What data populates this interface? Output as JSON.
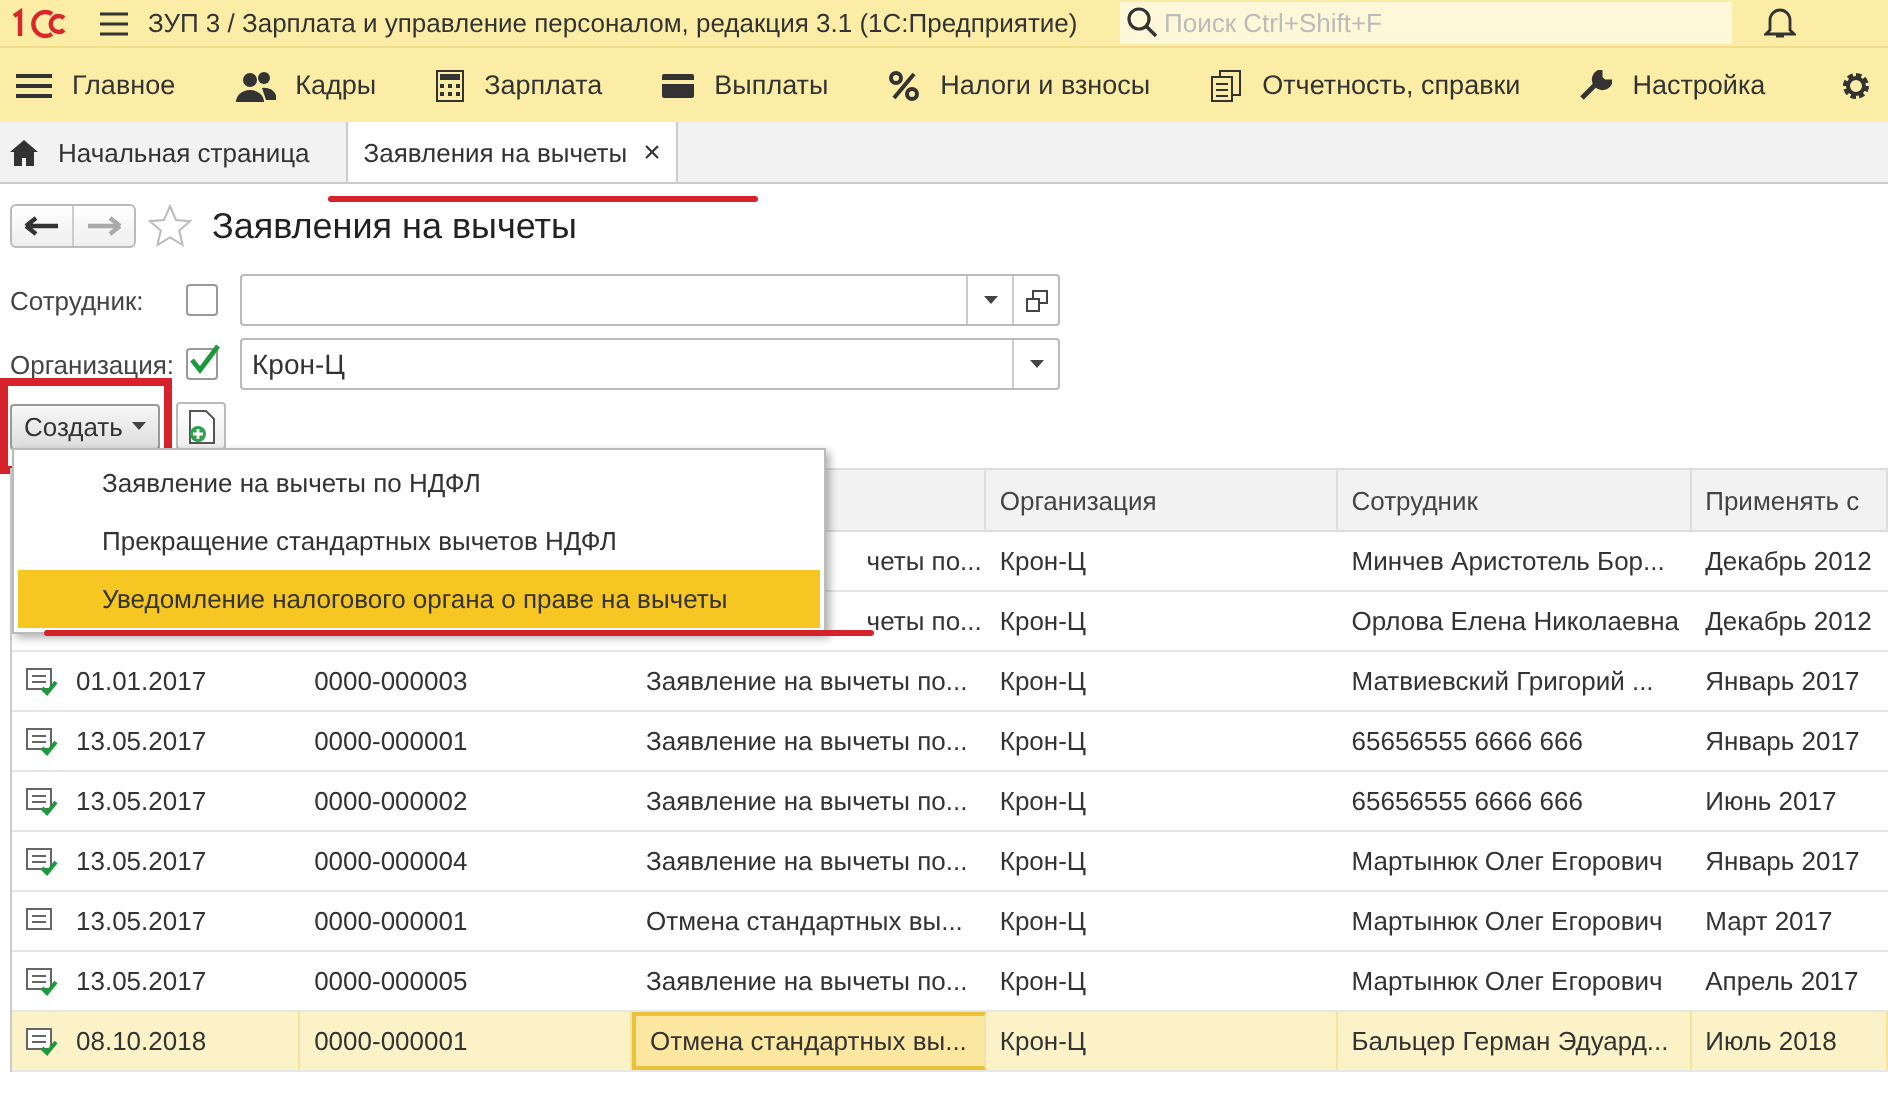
{
  "window": {
    "title": "ЗУП 3 / Зарплата и управление персоналом, редакция 3.1  (1С:Предприятие)",
    "search_placeholder": "Поиск Ctrl+Shift+F"
  },
  "sections": [
    {
      "label": "Главное"
    },
    {
      "label": "Кадры"
    },
    {
      "label": "Зарплата"
    },
    {
      "label": "Выплаты"
    },
    {
      "label": "Налоги и взносы"
    },
    {
      "label": "Отчетность, справки"
    },
    {
      "label": "Настройка"
    }
  ],
  "tabs": [
    {
      "label": "Начальная страница",
      "selected": false,
      "annotated": false
    },
    {
      "label": "Заявления на вычеты",
      "selected": true,
      "annotated": true,
      "close": "×"
    }
  ],
  "form": {
    "title": "Заявления на вычеты",
    "filters": [
      {
        "label": "Сотрудник:",
        "checked": false
      },
      {
        "label": "Организация:",
        "checked": true,
        "value": "Крон-Ц"
      }
    ],
    "create_button": {
      "label": "Создать",
      "annotated": true
    }
  },
  "menu": [
    {
      "label": "Заявление на вычеты по НДФЛ",
      "selected": false,
      "annotated": false
    },
    {
      "label": "Прекращение стандартных вычетов НДФЛ",
      "selected": false,
      "annotated": false
    },
    {
      "label": "Уведомление налогового органа о праве на вычеты",
      "selected": true,
      "annotated": true
    }
  ],
  "table": {
    "columns": [
      "",
      "",
      "",
      "Организация",
      "Сотрудник",
      "Применять с"
    ],
    "rows": [
      {
        "selected": false,
        "type": "четы по...",
        "org": "Крон-Ц",
        "employee": "Минчев Аристотель Бор...",
        "from": "Декабрь 2012"
      },
      {
        "selected": false,
        "type": "четы по...",
        "org": "Крон-Ц",
        "employee": "Орлова Елена Николаевна",
        "from": "Декабрь 2012"
      },
      {
        "posted": true,
        "selected": false,
        "date": "01.01.2017",
        "number": "0000-000003",
        "type": "Заявление на вычеты по...",
        "org": "Крон-Ц",
        "employee": "Матвиевский Григорий ...",
        "from": "Январь 2017"
      },
      {
        "posted": true,
        "selected": false,
        "date": "13.05.2017",
        "number": "0000-000001",
        "type": "Заявление на вычеты по...",
        "org": "Крон-Ц",
        "employee": "65656555 6666 666",
        "from": "Январь 2017"
      },
      {
        "posted": true,
        "selected": false,
        "date": "13.05.2017",
        "number": "0000-000002",
        "type": "Заявление на вычеты по...",
        "org": "Крон-Ц",
        "employee": "65656555 6666 666",
        "from": "Июнь 2017"
      },
      {
        "posted": true,
        "selected": false,
        "date": "13.05.2017",
        "number": "0000-000004",
        "type": "Заявление на вычеты по...",
        "org": "Крон-Ц",
        "employee": "Мартынюк Олег Егорович",
        "from": "Январь 2017"
      },
      {
        "posted": false,
        "selected": false,
        "date": "13.05.2017",
        "number": "0000-000001",
        "type": "Отмена стандартных вы...",
        "org": "Крон-Ц",
        "employee": "Мартынюк Олег Егорович",
        "from": "Март 2017"
      },
      {
        "posted": true,
        "selected": false,
        "date": "13.05.2017",
        "number": "0000-000005",
        "type": "Заявление на вычеты по...",
        "org": "Крон-Ц",
        "employee": "Мартынюк Олег Егорович",
        "from": "Апрель 2017"
      },
      {
        "posted": true,
        "selected": true,
        "date": "08.10.2018",
        "number": "0000-000001",
        "type": "Отмена стандартных вы...",
        "org": "Крон-Ц",
        "employee": "Бальцер Герман Эдуард...",
        "from": "Июль 2018"
      }
    ]
  }
}
